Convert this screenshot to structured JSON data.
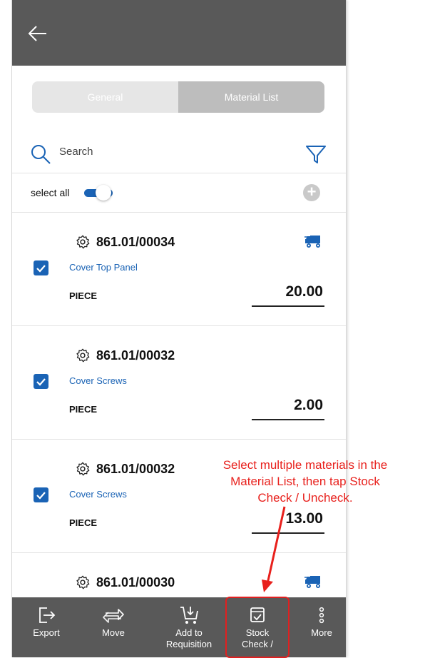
{
  "header": {
    "back_icon": "arrow-left-icon"
  },
  "tabs": [
    {
      "label": "General",
      "active": false
    },
    {
      "label": "Material List",
      "active": true
    }
  ],
  "search": {
    "label": "Search"
  },
  "select_all": {
    "label": "select all",
    "on": true
  },
  "items": [
    {
      "code": "861.01/00034",
      "description": "Cover Top Panel",
      "unit": "PIECE",
      "quantity": "20.00",
      "checked": true,
      "truck": true
    },
    {
      "code": "861.01/00032",
      "description": "Cover Screws",
      "unit": "PIECE",
      "quantity": "2.00",
      "checked": true,
      "truck": false
    },
    {
      "code": "861.01/00032",
      "description": "Cover Screws",
      "unit": "PIECE",
      "quantity": "13.00",
      "checked": true,
      "truck": false
    },
    {
      "code": "861.01/00030",
      "truck": true
    }
  ],
  "bottom_nav": [
    {
      "label": "Export",
      "icon": "export-icon"
    },
    {
      "label": "Move",
      "icon": "move-arrows-icon"
    },
    {
      "label": "Add to Requisition",
      "line1": "Add to",
      "line2": "Requisition",
      "icon": "cart-download-icon"
    },
    {
      "label": "Stock Check /",
      "line1": "Stock",
      "line2": "Check /",
      "icon": "stock-check-box-icon"
    },
    {
      "label": "More",
      "icon": "more-vertical-icon"
    }
  ],
  "annotation": {
    "line1": "Select multiple materials in the",
    "line2": "Material List, then tap Stock",
    "line3": "Check / Uncheck."
  },
  "colors": {
    "header_bg": "#595959",
    "accent": "#1a63b5",
    "annotation": "#e8201c"
  }
}
